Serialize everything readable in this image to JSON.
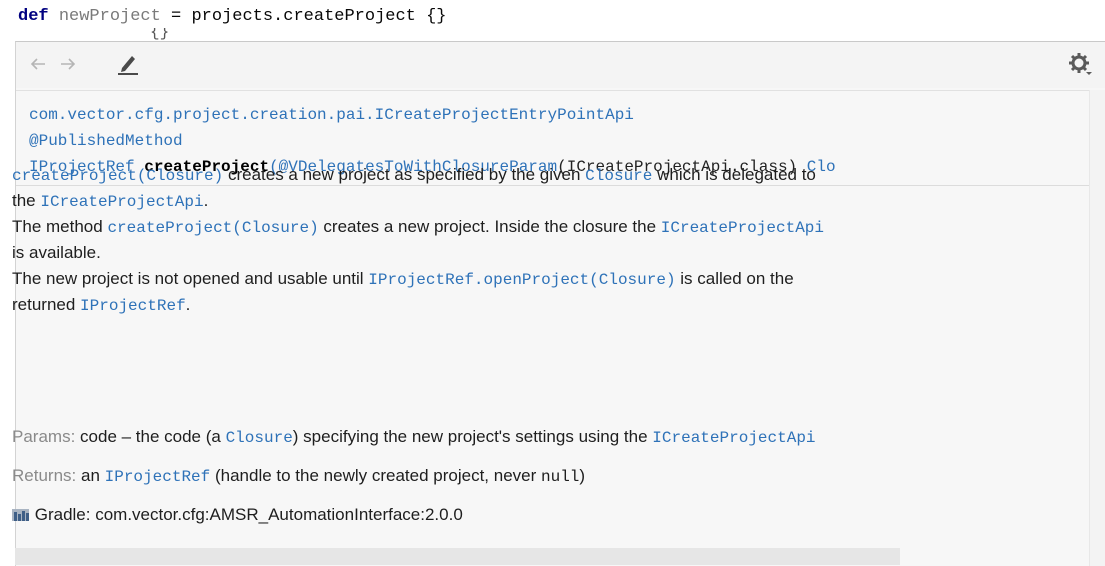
{
  "editor": {
    "keyword": "def",
    "var_name": "newProject",
    "rest": " = projects.createProject {}",
    "fragment": "{}"
  },
  "toolbar": {
    "back_icon": "arrow-left-icon",
    "forward_icon": "arrow-right-icon",
    "edit_icon": "pencil-icon",
    "settings_icon": "gear-icon"
  },
  "signature": {
    "class_path": "com.vector.cfg.project.creation.pai.ICreateProjectEntryPointApi",
    "annotation": "@PublishedMethod",
    "return_type": "IProjectRef",
    "method_name": "createProject",
    "param_annotation": "(@VDelegatesToWithClosureParam",
    "param_type": "(ICreateProjectApi.class)",
    "param_tail": "Clo"
  },
  "doc": {
    "p1_code1": "createProject(Closure)",
    "p1_text1": " creates a new project as specified by the given ",
    "p1_code2": "Closure",
    "p1_text2": " which is delegated to",
    "p1_text3": "the ",
    "p1_code3": "ICreateProjectApi",
    "p1_text4": ".",
    "p2_text1": "The method ",
    "p2_code1": "createProject(Closure)",
    "p2_text2": " creates a new project. Inside the closure the ",
    "p2_code2": "ICreateProjectApi",
    "p2_text3": "is available.",
    "p3_text1": "The new project is not opened and usable until ",
    "p3_code1": "IProjectRef.openProject(Closure)",
    "p3_text2": " is called on the",
    "p3_text3": "returned ",
    "p3_code2": "IProjectRef",
    "p3_text4": ".",
    "params_label": "Params: ",
    "params_text1": "code – the code (a ",
    "params_code1": "Closure",
    "params_text2": ") specifying the new project's settings using the ",
    "params_code2": "ICreateProjectApi",
    "returns_label": "Returns: ",
    "returns_text1": "an ",
    "returns_code1": "IProjectRef",
    "returns_text2": " (handle to the newly created project, never ",
    "returns_code2": "null",
    "returns_text3": ")",
    "library_icon": "library-icon",
    "library": "Gradle: com.vector.cfg:AMSR_AutomationInterface:2.0.0"
  }
}
